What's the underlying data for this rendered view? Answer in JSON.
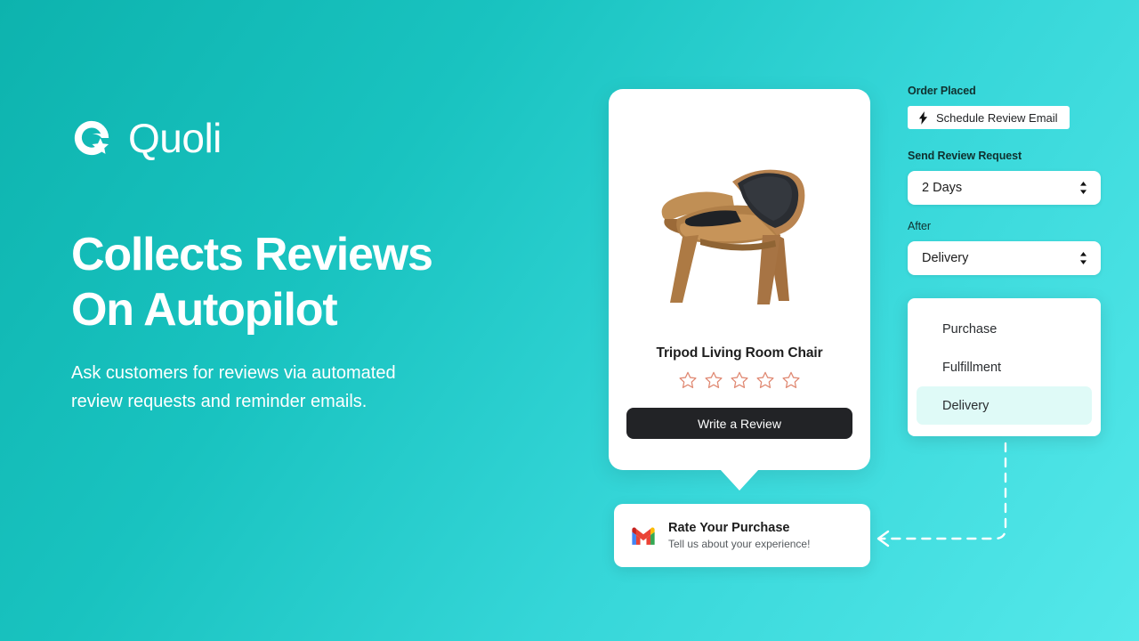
{
  "theme": {
    "bg_gradient_start": "#0db3ae",
    "bg_gradient_end": "#55e8ea",
    "card_bg": "#ffffff",
    "dark_button": "#222326",
    "star_outline": "#e08a74",
    "dropdown_highlight": "#dffaf7",
    "text_dark": "#1c1c1c"
  },
  "brand": {
    "name": "Quoli",
    "logo_icon": "quoli-q-star-icon"
  },
  "hero": {
    "headline": "Collects Reviews\nOn Autopilot",
    "subheadline": "Ask customers for reviews via automated\nreview requests and reminder emails."
  },
  "product_card": {
    "image_alt": "tripod-shell-chair-image",
    "title": "Tripod Living Room Chair",
    "rating": {
      "value": 0,
      "max": 5,
      "icon": "star-outline-icon"
    },
    "cta_label": "Write a Review"
  },
  "email_notification": {
    "icon": "gmail-icon",
    "title": "Rate Your Purchase",
    "subtitle": "Tell us about your experience!"
  },
  "workflow": {
    "trigger_label": "Order Placed",
    "schedule_button": {
      "icon": "lightning-bolt-icon",
      "label": "Schedule Review Email"
    },
    "delay_label": "Send Review Request",
    "delay_value": "2 Days",
    "after_label": "After",
    "after_value": "Delivery",
    "dropdown_options": [
      {
        "label": "Purchase",
        "selected": false
      },
      {
        "label": "Fulfillment",
        "selected": false
      },
      {
        "label": "Delivery",
        "selected": true
      }
    ]
  },
  "connector": {
    "icon": "dashed-arrow-left-icon"
  }
}
